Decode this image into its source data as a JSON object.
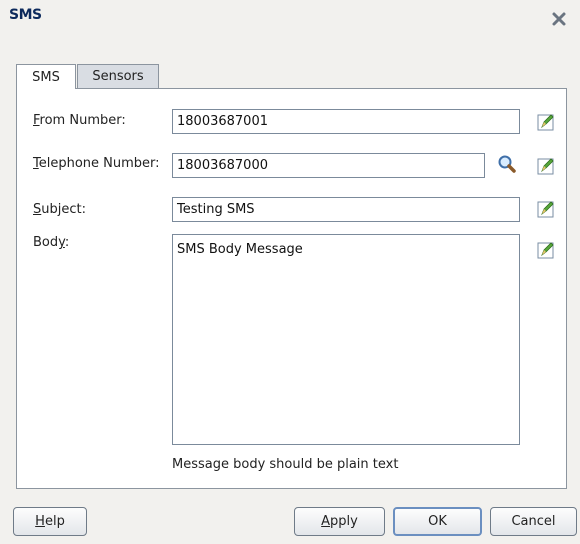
{
  "dialog": {
    "title": "SMS"
  },
  "tabs": [
    {
      "label": "SMS",
      "active": true
    },
    {
      "label": "Sensors",
      "active": false
    }
  ],
  "form": {
    "from_number": {
      "mnemonic": "F",
      "label_rest": "rom Number:",
      "value": "18003687001"
    },
    "telephone_number": {
      "mnemonic": "T",
      "label_rest": "elephone Number:",
      "value": "18003687000"
    },
    "subject": {
      "mnemonic": "S",
      "label_rest": "ubject:",
      "value": "Testing SMS"
    },
    "body": {
      "label_pre": "Bod",
      "mnemonic": "y",
      "label_rest": ":",
      "value": "SMS Body Message"
    },
    "hint": "Message body should be plain text"
  },
  "buttons": {
    "help": {
      "mnemonic": "H",
      "rest": "elp"
    },
    "apply": {
      "mnemonic": "A",
      "rest": "pply"
    },
    "ok": "OK",
    "cancel": "Cancel"
  },
  "icons": {
    "close": "close-icon",
    "search": "search-icon",
    "edit": "edit-icon"
  }
}
